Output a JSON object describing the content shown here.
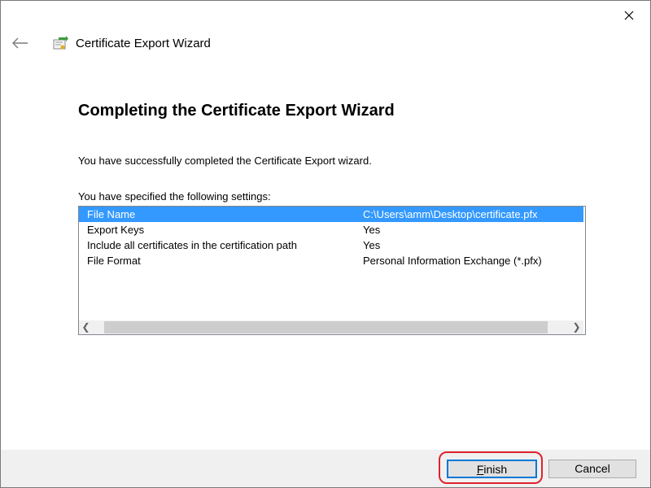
{
  "window": {
    "title": "Certificate Export Wizard",
    "close_icon": "close-icon",
    "back_icon": "back-arrow-icon",
    "app_icon": "certificate-wizard-icon"
  },
  "content": {
    "heading": "Completing the Certificate Export Wizard",
    "success_text": "You have successfully completed the Certificate Export wizard.",
    "settings_label": "You have specified the following settings:"
  },
  "settings": {
    "rows": [
      {
        "name": "File Name",
        "value": "C:\\Users\\amm\\Desktop\\certificate.pfx",
        "selected": true
      },
      {
        "name": "Export Keys",
        "value": "Yes",
        "selected": false
      },
      {
        "name": "Include all certificates in the certification path",
        "value": "Yes",
        "selected": false
      },
      {
        "name": "File Format",
        "value": "Personal Information Exchange (*.pfx)",
        "selected": false
      }
    ],
    "scroll_left_icon": "scroll-left-icon",
    "scroll_right_icon": "scroll-right-icon"
  },
  "footer": {
    "finish_label_mnemonic": "F",
    "finish_label_rest": "inish",
    "cancel_label": "Cancel"
  },
  "colors": {
    "selection": "#3399ff",
    "focus_border": "#0078d7",
    "annotation_ring": "#e0212d"
  }
}
